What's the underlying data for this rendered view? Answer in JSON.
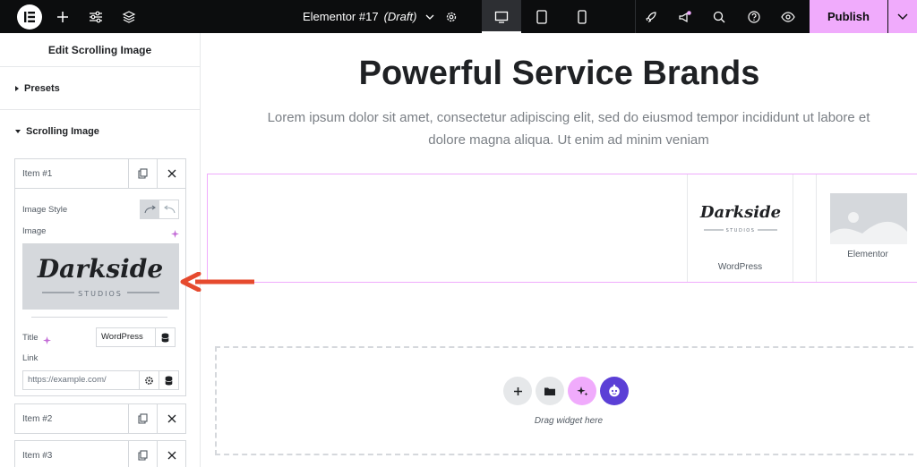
{
  "topbar": {
    "doc_title": "Elementor #17",
    "doc_status": "(Draft)",
    "publish_label": "Publish"
  },
  "panel": {
    "header": "Edit Scrolling Image",
    "sections": {
      "presets": "Presets",
      "scrolling_image": "Scrolling Image"
    },
    "items": [
      {
        "label": "Item #1"
      },
      {
        "label": "Item #2"
      },
      {
        "label": "Item #3"
      }
    ],
    "fields": {
      "image_style_label": "Image Style",
      "image_label": "Image",
      "title_label": "Title",
      "title_value": "WordPress",
      "link_label": "Link",
      "link_placeholder": "https://example.com/"
    },
    "preview_logo": {
      "wordmark": "Darkside",
      "tagline": "STUDIOS"
    }
  },
  "canvas": {
    "headline": "Powerful Service Brands",
    "subtitle": "Lorem ipsum dolor sit amet, consectetur adipiscing elit, sed do eiusmod tempor incididunt ut labore et dolore magna aliqua. Ut enim ad minim veniam",
    "cards": [
      {
        "caption": "WordPress",
        "logo_wordmark": "Darkside",
        "logo_tagline": "STUDIOS"
      },
      {
        "caption": "Elementor"
      }
    ],
    "drag_text": "Drag widget here"
  },
  "colors": {
    "accent_pink": "#f0abfc",
    "arrow": "#e64a2e",
    "ai_purple": "#5b3fd6",
    "topbar_bg": "#0c0d0e"
  },
  "icons": [
    "elementor-logo-icon",
    "plus-icon",
    "sliders-icon",
    "layers-icon",
    "chevron-down-icon",
    "gear-icon",
    "desktop-icon",
    "tablet-icon",
    "mobile-icon",
    "rocket-icon",
    "megaphone-icon",
    "search-icon",
    "help-icon",
    "eye-icon",
    "copy-icon",
    "close-icon",
    "sparkle-icon",
    "database-icon",
    "folder-icon",
    "ai-robot-icon"
  ]
}
